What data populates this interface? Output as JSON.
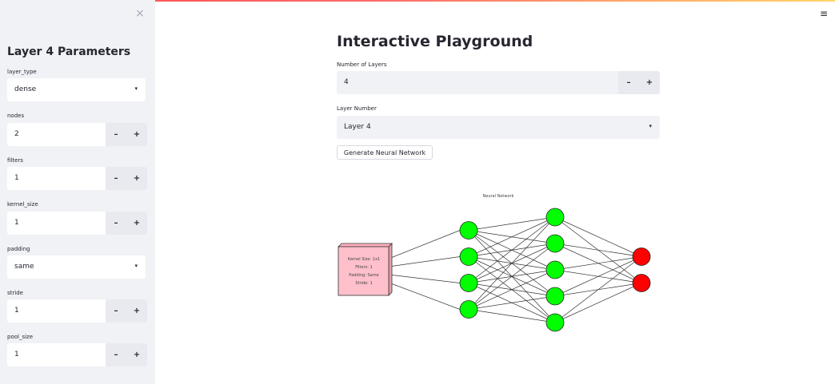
{
  "sidebar": {
    "close_icon": "×",
    "title": "Layer 4 Parameters",
    "fields": {
      "layer_type": {
        "label": "layer_type",
        "value": "dense"
      },
      "nodes": {
        "label": "nodes",
        "value": "2"
      },
      "filters": {
        "label": "filters",
        "value": "1"
      },
      "kernel_size": {
        "label": "kernel_size",
        "value": "1"
      },
      "padding": {
        "label": "padding",
        "value": "same"
      },
      "stride": {
        "label": "stride",
        "value": "1"
      },
      "pool_size": {
        "label": "pool_size",
        "value": "1"
      }
    },
    "minus": "–",
    "plus": "+",
    "caret": "▾"
  },
  "main": {
    "menu_icon": "≡",
    "title": "Interactive Playground",
    "num_layers": {
      "label": "Number of Layers",
      "value": "4"
    },
    "layer_number": {
      "label": "Layer Number",
      "value": "Layer 4"
    },
    "generate_button": "Generate Neural Network"
  },
  "network": {
    "title": "Neural Network",
    "conv_block_lines": [
      "Kernel Size: 1x1",
      "Filters: 1",
      "Padding: Same",
      "Stride: 1"
    ],
    "layers": [
      {
        "type": "conv",
        "nodes": 4
      },
      {
        "type": "dense",
        "nodes": 4,
        "color": "#00ff00"
      },
      {
        "type": "dense",
        "nodes": 5,
        "color": "#00ff00"
      },
      {
        "type": "dense",
        "nodes": 2,
        "color": "#ff0000"
      }
    ],
    "conv_color": "#ffc0cb"
  }
}
